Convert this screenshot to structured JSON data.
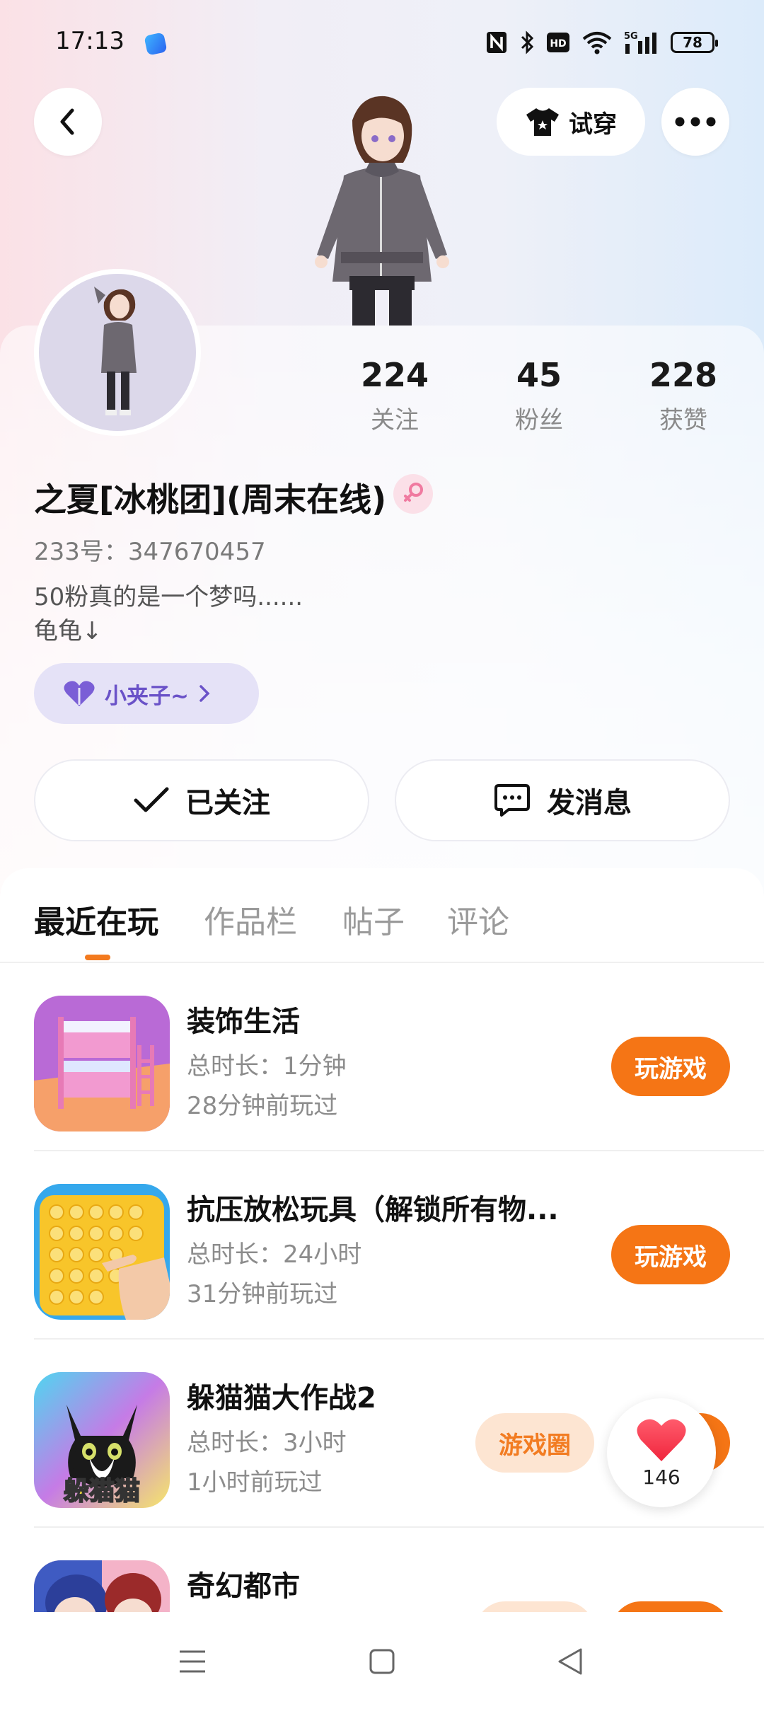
{
  "status_bar": {
    "time": "17:13",
    "network_label": "5G",
    "hd_label": "HD",
    "battery": "78"
  },
  "header": {
    "tryon_label": "试穿"
  },
  "profile": {
    "stats": [
      {
        "value": "224",
        "label": "关注"
      },
      {
        "value": "45",
        "label": "粉丝"
      },
      {
        "value": "228",
        "label": "获赞"
      }
    ],
    "nickname": "之夏[冰桃团](周末在线)",
    "gender_symbol": "♀",
    "user_id": "233号：347670457",
    "bio": "50粉真的是一个梦吗......\n龟龟↓",
    "tag": "小夹子~",
    "follow_label": "已关注",
    "message_label": "发消息"
  },
  "tabs": [
    {
      "label": "最近在玩",
      "active": true
    },
    {
      "label": "作品栏",
      "active": false
    },
    {
      "label": "帖子",
      "active": false
    },
    {
      "label": "评论",
      "active": false
    }
  ],
  "games": [
    {
      "title": "装饰生活",
      "duration": "总时长：1分钟",
      "last_played": "28分钟前玩过",
      "play_label": "玩游戏"
    },
    {
      "title": "抗压放松玩具（解锁所有物...",
      "duration": "总时长：24小时",
      "last_played": "31分钟前玩过",
      "play_label": "玩游戏"
    },
    {
      "title": "躲猫猫大作战2",
      "duration": "总时长：3小时",
      "last_played": "1小时前玩过",
      "play_label": "玩游戏",
      "circle_label": "游戏圈",
      "icon_text": "躲猫猫"
    },
    {
      "title": "奇幻都市",
      "duration": "",
      "last_played": "",
      "play_label": "玩游戏"
    }
  ],
  "like_fab": {
    "count": "146"
  },
  "colors": {
    "accent_orange": "#f57515",
    "tag_purple": "#6a52c8",
    "gender_pink": "#f07aa0"
  }
}
